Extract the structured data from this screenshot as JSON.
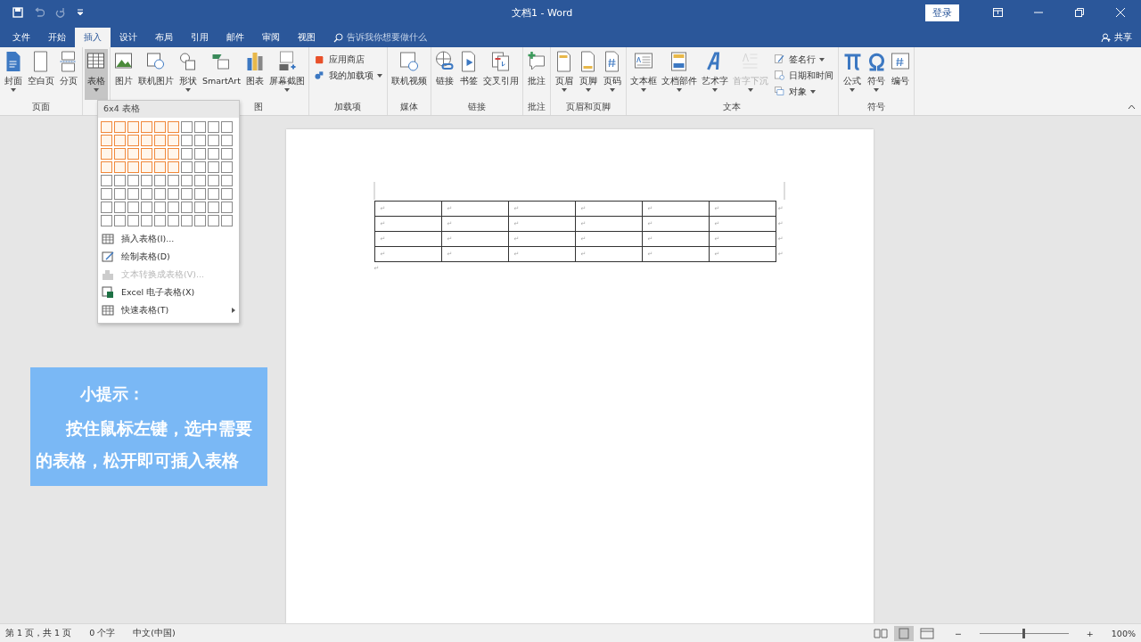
{
  "window": {
    "title": "文档1  -  Word",
    "login": "登录",
    "share": "共享"
  },
  "quick_access": [
    {
      "kind": "save",
      "disabled": false
    },
    {
      "kind": "undo",
      "disabled": true
    },
    {
      "kind": "redo",
      "disabled": true
    },
    {
      "kind": "customize",
      "disabled": false
    }
  ],
  "tabs": [
    {
      "label": "文件",
      "selected": false
    },
    {
      "label": "开始",
      "selected": false
    },
    {
      "label": "插入",
      "selected": true
    },
    {
      "label": "设计",
      "selected": false
    },
    {
      "label": "布局",
      "selected": false
    },
    {
      "label": "引用",
      "selected": false
    },
    {
      "label": "邮件",
      "selected": false
    },
    {
      "label": "审阅",
      "selected": false
    },
    {
      "label": "视图",
      "selected": false
    }
  ],
  "search": {
    "placeholder": "告诉我你想要做什么"
  },
  "ribbon_groups": [
    {
      "label": "页面",
      "buttons": [
        {
          "kind": "large",
          "label": "封面",
          "dropdown": true,
          "pressed": false,
          "disabled": false
        },
        {
          "kind": "large",
          "label": "空白页",
          "dropdown": false,
          "pressed": false,
          "disabled": false
        },
        {
          "kind": "large",
          "label": "分页",
          "dropdown": false,
          "pressed": false,
          "disabled": false
        }
      ]
    },
    {
      "buttons": [
        {
          "kind": "large",
          "label": "表格",
          "dropdown": true,
          "pressed": true,
          "disabled": false
        }
      ]
    },
    {
      "label": "图",
      "buttons": [
        {
          "kind": "large",
          "label": "图片",
          "dropdown": false,
          "pressed": false,
          "disabled": false
        },
        {
          "kind": "large",
          "label": "联机图片",
          "dropdown": false,
          "pressed": false,
          "disabled": false
        },
        {
          "kind": "large",
          "label": "形状",
          "dropdown": true,
          "pressed": false,
          "disabled": false
        },
        {
          "kind": "large",
          "label": "SmartArt",
          "dropdown": false,
          "pressed": false,
          "disabled": false
        },
        {
          "kind": "large",
          "label": "图表",
          "dropdown": false,
          "pressed": false,
          "disabled": false
        },
        {
          "kind": "large",
          "label": "屏幕截图",
          "dropdown": true,
          "pressed": false,
          "disabled": false
        }
      ]
    },
    {
      "label": "加载项",
      "buttons": [
        {
          "kind": "small",
          "label": "应用商店",
          "dropdown": false,
          "pressed": false,
          "disabled": false
        },
        {
          "kind": "small",
          "label": "我的加载项",
          "dropdown": true,
          "pressed": false,
          "disabled": false
        }
      ]
    },
    {
      "label": "媒体",
      "buttons": [
        {
          "kind": "large",
          "label": "联机视频",
          "dropdown": false,
          "pressed": false,
          "disabled": false
        }
      ]
    },
    {
      "label": "链接",
      "buttons": [
        {
          "kind": "large",
          "label": "链接",
          "dropdown": false,
          "pressed": false,
          "disabled": false
        },
        {
          "kind": "large",
          "label": "书签",
          "dropdown": false,
          "pressed": false,
          "disabled": false
        },
        {
          "kind": "large",
          "label": "交叉引用",
          "dropdown": false,
          "pressed": false,
          "disabled": false
        }
      ]
    },
    {
      "label": "批注",
      "buttons": [
        {
          "kind": "large",
          "label": "批注",
          "dropdown": false,
          "pressed": false,
          "disabled": false
        }
      ]
    },
    {
      "label": "页眉和页脚",
      "buttons": [
        {
          "kind": "large",
          "label": "页眉",
          "dropdown": true,
          "pressed": false,
          "disabled": false
        },
        {
          "kind": "large",
          "label": "页脚",
          "dropdown": true,
          "pressed": false,
          "disabled": false
        },
        {
          "kind": "large",
          "label": "页码",
          "dropdown": true,
          "pressed": false,
          "disabled": false
        }
      ]
    },
    {
      "label": "文本",
      "buttons": [
        {
          "kind": "large",
          "label": "文本框",
          "dropdown": true,
          "pressed": false,
          "disabled": false
        },
        {
          "kind": "large",
          "label": "文档部件",
          "dropdown": true,
          "pressed": false,
          "disabled": false
        },
        {
          "kind": "large",
          "label": "艺术字",
          "dropdown": true,
          "pressed": false,
          "disabled": false
        },
        {
          "kind": "large",
          "label": "首字下沉",
          "dropdown": true,
          "pressed": false,
          "disabled": true
        },
        {
          "kind": "small",
          "label": "签名行",
          "dropdown": true,
          "pressed": false,
          "disabled": false
        },
        {
          "kind": "small",
          "label": "日期和时间",
          "dropdown": false,
          "pressed": false,
          "disabled": false
        },
        {
          "kind": "small",
          "label": "对象",
          "dropdown": true,
          "pressed": false,
          "disabled": false
        }
      ]
    },
    {
      "label": "符号",
      "buttons": [
        {
          "kind": "large",
          "label": "公式",
          "dropdown": true,
          "pressed": false,
          "disabled": false
        },
        {
          "kind": "large",
          "label": "符号",
          "dropdown": true,
          "pressed": false,
          "disabled": false
        },
        {
          "kind": "large",
          "label": "编号",
          "dropdown": false,
          "pressed": false,
          "disabled": false
        }
      ]
    }
  ],
  "table_menu": {
    "title": "6x4 表格",
    "grid": [
      {
        "cells": [
          {
            "selected": true
          },
          {
            "selected": true
          },
          {
            "selected": true
          },
          {
            "selected": true
          },
          {
            "selected": true
          },
          {
            "selected": true
          },
          {
            "selected": false
          },
          {
            "selected": false
          },
          {
            "selected": false
          },
          {
            "selected": false
          }
        ]
      },
      {
        "cells": [
          {
            "selected": true
          },
          {
            "selected": true
          },
          {
            "selected": true
          },
          {
            "selected": true
          },
          {
            "selected": true
          },
          {
            "selected": true
          },
          {
            "selected": false
          },
          {
            "selected": false
          },
          {
            "selected": false
          },
          {
            "selected": false
          }
        ]
      },
      {
        "cells": [
          {
            "selected": true
          },
          {
            "selected": true
          },
          {
            "selected": true
          },
          {
            "selected": true
          },
          {
            "selected": true
          },
          {
            "selected": true
          },
          {
            "selected": false
          },
          {
            "selected": false
          },
          {
            "selected": false
          },
          {
            "selected": false
          }
        ]
      },
      {
        "cells": [
          {
            "selected": true
          },
          {
            "selected": true
          },
          {
            "selected": true
          },
          {
            "selected": true
          },
          {
            "selected": true
          },
          {
            "selected": true
          },
          {
            "selected": false
          },
          {
            "selected": false
          },
          {
            "selected": false
          },
          {
            "selected": false
          }
        ]
      },
      {
        "cells": [
          {
            "selected": false
          },
          {
            "selected": false
          },
          {
            "selected": false
          },
          {
            "selected": false
          },
          {
            "selected": false
          },
          {
            "selected": false
          },
          {
            "selected": false
          },
          {
            "selected": false
          },
          {
            "selected": false
          },
          {
            "selected": false
          }
        ]
      },
      {
        "cells": [
          {
            "selected": false
          },
          {
            "selected": false
          },
          {
            "selected": false
          },
          {
            "selected": false
          },
          {
            "selected": false
          },
          {
            "selected": false
          },
          {
            "selected": false
          },
          {
            "selected": false
          },
          {
            "selected": false
          },
          {
            "selected": false
          }
        ]
      },
      {
        "cells": [
          {
            "selected": false
          },
          {
            "selected": false
          },
          {
            "selected": false
          },
          {
            "selected": false
          },
          {
            "selected": false
          },
          {
            "selected": false
          },
          {
            "selected": false
          },
          {
            "selected": false
          },
          {
            "selected": false
          },
          {
            "selected": false
          }
        ]
      },
      {
        "cells": [
          {
            "selected": false
          },
          {
            "selected": false
          },
          {
            "selected": false
          },
          {
            "selected": false
          },
          {
            "selected": false
          },
          {
            "selected": false
          },
          {
            "selected": false
          },
          {
            "selected": false
          },
          {
            "selected": false
          },
          {
            "selected": false
          }
        ]
      }
    ],
    "items": [
      {
        "kind": "insert",
        "label": "插入表格(I)...",
        "disabled": false,
        "submenu": false
      },
      {
        "kind": "draw",
        "label": "绘制表格(D)",
        "disabled": false,
        "submenu": false
      },
      {
        "kind": "convert",
        "label": "文本转换成表格(V)...",
        "disabled": true,
        "submenu": false
      },
      {
        "kind": "excel",
        "label": "Excel 电子表格(X)",
        "disabled": false,
        "submenu": false
      },
      {
        "kind": "quick",
        "label": "快速表格(T)",
        "disabled": false,
        "submenu": true
      }
    ]
  },
  "document": {
    "table": {
      "rows": [
        [
          "↵",
          "↵",
          "↵",
          "↵",
          "↵",
          "↵"
        ],
        [
          "↵",
          "↵",
          "↵",
          "↵",
          "↵",
          "↵"
        ],
        [
          "↵",
          "↵",
          "↵",
          "↵",
          "↵",
          "↵"
        ],
        [
          "↵",
          "↵",
          "↵",
          "↵",
          "↵",
          "↵"
        ]
      ],
      "row_marks": [
        "↵",
        "↵",
        "↵",
        "↵"
      ]
    },
    "paragraph_mark": "↵"
  },
  "tip": {
    "title": "小提示：",
    "text": "按住鼠标左键，选中需要的表格，松开即可插入表格"
  },
  "status_bar": {
    "page": "第 1 页，共 1 页",
    "words": "0 个字",
    "language": "中文(中国)",
    "zoom_minus": "−",
    "zoom_plus": "+",
    "zoom": {
      "level": 0.5
    },
    "zoom_text": "100%",
    "views": [
      {
        "kind": "read",
        "selected": false
      },
      {
        "kind": "print",
        "selected": true
      },
      {
        "kind": "web",
        "selected": false
      }
    ]
  }
}
